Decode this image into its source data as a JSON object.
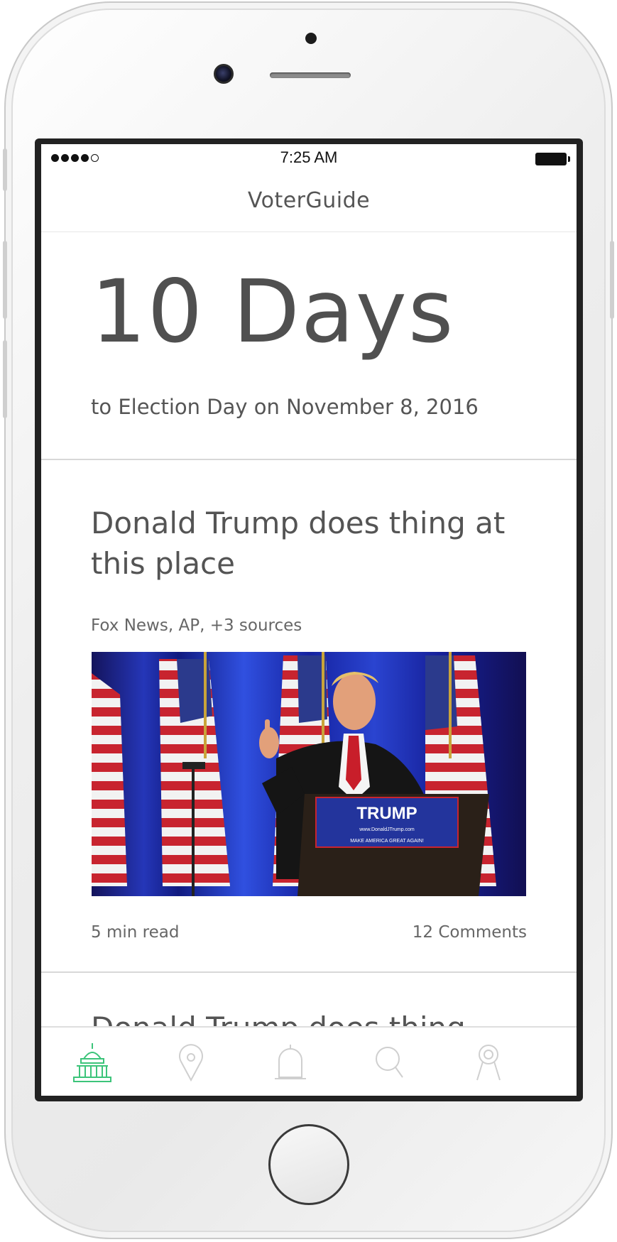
{
  "status_bar": {
    "time": "7:25 AM"
  },
  "nav": {
    "title": "VoterGuide"
  },
  "countdown": {
    "big": "10 Days",
    "sub": "to Election Day on November 8, 2016"
  },
  "article": {
    "headline": "Donald Trump does thing at this place",
    "sources": "Fox News, AP, +3 sources",
    "image_alt": "Donald Trump speaking at a podium with American flags",
    "podium_sign": "TRUMP",
    "podium_url": "www.DonaldJTrump.com",
    "podium_slogan": "MAKE AMERICA GREAT AGAIN!",
    "read_time": "5 min read",
    "comments": "12 Comments"
  },
  "next_article": {
    "headline": "Donald Trump does thing"
  },
  "tabs": [
    {
      "name": "capitol-icon",
      "active": true
    },
    {
      "name": "location-pin-icon",
      "active": false
    },
    {
      "name": "bell-icon",
      "active": false
    },
    {
      "name": "search-icon",
      "active": false
    },
    {
      "name": "profile-icon",
      "active": false
    }
  ],
  "colors": {
    "active_tab": "#3cc47a",
    "inactive_tab": "#cfcfcf",
    "text_primary": "#545454",
    "divider": "#d8d8d8"
  }
}
